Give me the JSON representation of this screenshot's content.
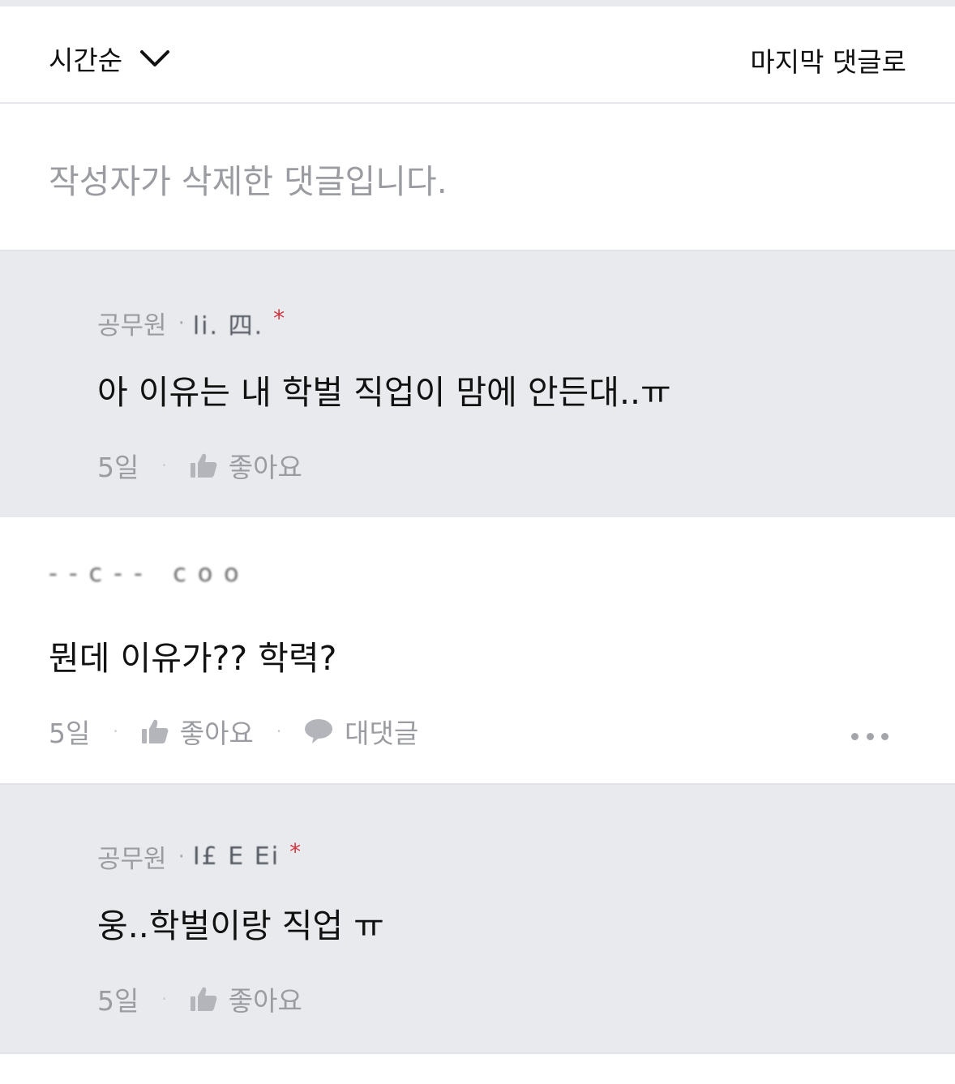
{
  "sort": {
    "current": "시간순",
    "jump_label": "마지막 댓글로"
  },
  "deleted_comment": {
    "text": "작성자가 삭제한 댓글입니다."
  },
  "comments": [
    {
      "type": "reply",
      "author_role": "공무원",
      "author_nick": "li. 四.",
      "is_author": true,
      "text": "아 이유는 내 학벌 직업이 맘에 안든대..ㅠ",
      "time": "5일",
      "like_label": "좋아요"
    },
    {
      "type": "comment",
      "author_nick": "--c-- coo",
      "text": "뭔데 이유가?? 학력?",
      "time": "5일",
      "like_label": "좋아요",
      "reply_label": "대댓글"
    },
    {
      "type": "reply",
      "author_role": "공무원",
      "author_nick": "I£ E Ei",
      "is_author": true,
      "text": "웅..학벌이랑 직업 ㅠ",
      "time": "5일",
      "like_label": "좋아요"
    }
  ],
  "icons": {
    "sort": "chevron-down-icon",
    "like": "thumbs-up-icon",
    "reply": "speech-bubble-icon",
    "more": "more-dots-icon"
  },
  "colors": {
    "reply_bg": "#e9eaee",
    "muted_text": "#9a9ca1",
    "author_star": "#d0343f"
  }
}
